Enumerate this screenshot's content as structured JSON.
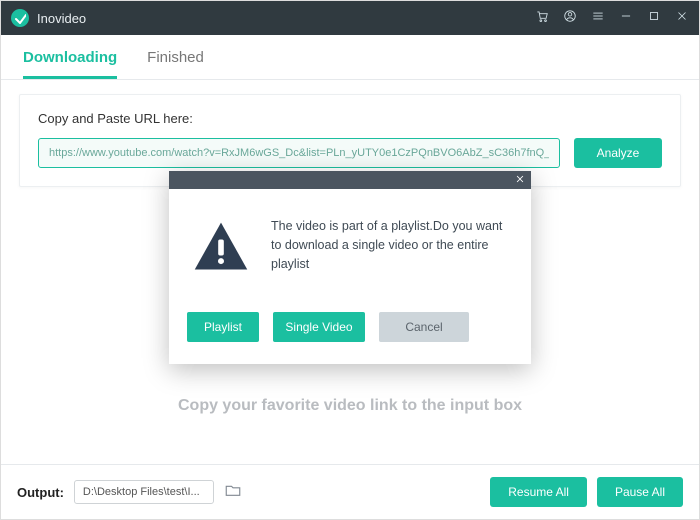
{
  "titlebar": {
    "app_name": "Inovideo"
  },
  "tabs": {
    "downloading": "Downloading",
    "finished": "Finished"
  },
  "input_card": {
    "label": "Copy and Paste URL here:",
    "url_value": "https://www.youtube.com/watch?v=RxJM6wGS_Dc&list=PLn_yUTY0e1CzPQnBVO6AbZ_sC36h7fnQ_",
    "analyze_label": "Analyze"
  },
  "placeholder": "Copy your favorite video link to the input box",
  "bottombar": {
    "output_label": "Output:",
    "output_path": "D:\\Desktop Files\\test\\I...",
    "resume_label": "Resume All",
    "pause_label": "Pause All"
  },
  "modal": {
    "message": "The video is part of a playlist.Do you want to download a single video or the entire playlist",
    "playlist_label": "Playlist",
    "single_label": "Single Video",
    "cancel_label": "Cancel"
  }
}
